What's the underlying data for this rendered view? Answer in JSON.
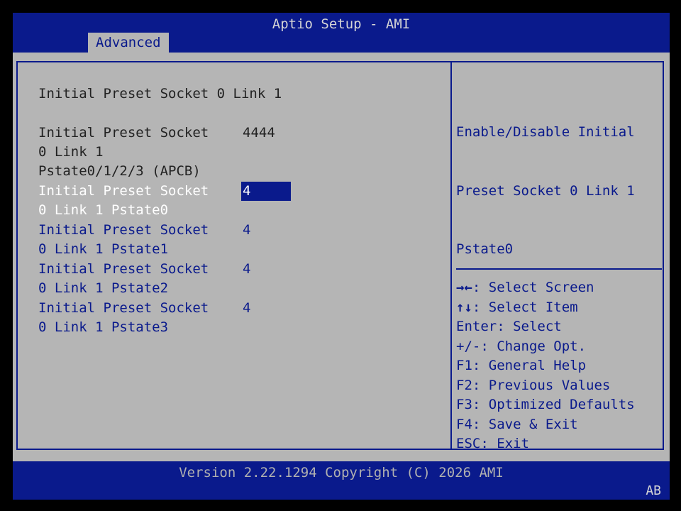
{
  "header": {
    "title": "Aptio Setup - AMI",
    "active_tab": "Advanced"
  },
  "left_panel": {
    "section_title": "Initial Preset Socket 0 Link 1",
    "apcb": {
      "label_line1": "Initial Preset Socket",
      "label_line2": "0 Link 1",
      "label_line3": "Pstate0/1/2/3 (APCB)",
      "value": "4444"
    },
    "items": [
      {
        "label_line1": "Initial Preset Socket",
        "label_line2": "0 Link 1 Pstate0",
        "value": "4",
        "selected": true
      },
      {
        "label_line1": "Initial Preset Socket",
        "label_line2": "0 Link 1 Pstate1",
        "value": "4"
      },
      {
        "label_line1": "Initial Preset Socket",
        "label_line2": "0 Link 1 Pstate2",
        "value": "4"
      },
      {
        "label_line1": "Initial Preset Socket",
        "label_line2": "0 Link 1 Pstate3",
        "value": "4"
      }
    ]
  },
  "help_panel": {
    "lines": [
      "Enable/Disable Initial",
      "Preset Socket 0 Link 1",
      "Pstate0"
    ]
  },
  "key_help": [
    {
      "glyph": "→←",
      "text": ": Select Screen"
    },
    {
      "glyph": "↑↓",
      "text": ": Select Item"
    },
    {
      "glyph": "",
      "text": "Enter: Select"
    },
    {
      "glyph": "",
      "text": "+/-: Change Opt."
    },
    {
      "glyph": "",
      "text": "F1: General Help"
    },
    {
      "glyph": "",
      "text": "F2: Previous Values"
    },
    {
      "glyph": "",
      "text": "F3: Optimized Defaults"
    },
    {
      "glyph": "",
      "text": "F4: Save & Exit"
    },
    {
      "glyph": "",
      "text": "ESC: Exit"
    }
  ],
  "footer": {
    "version": "Version 2.22.1294 Copyright (C) 2026 AMI",
    "badge": "AB"
  },
  "colors": {
    "bios_blue": "#0a1a8c",
    "panel_gray": "#b5b5b5",
    "highlight_white": "#ffffff"
  }
}
